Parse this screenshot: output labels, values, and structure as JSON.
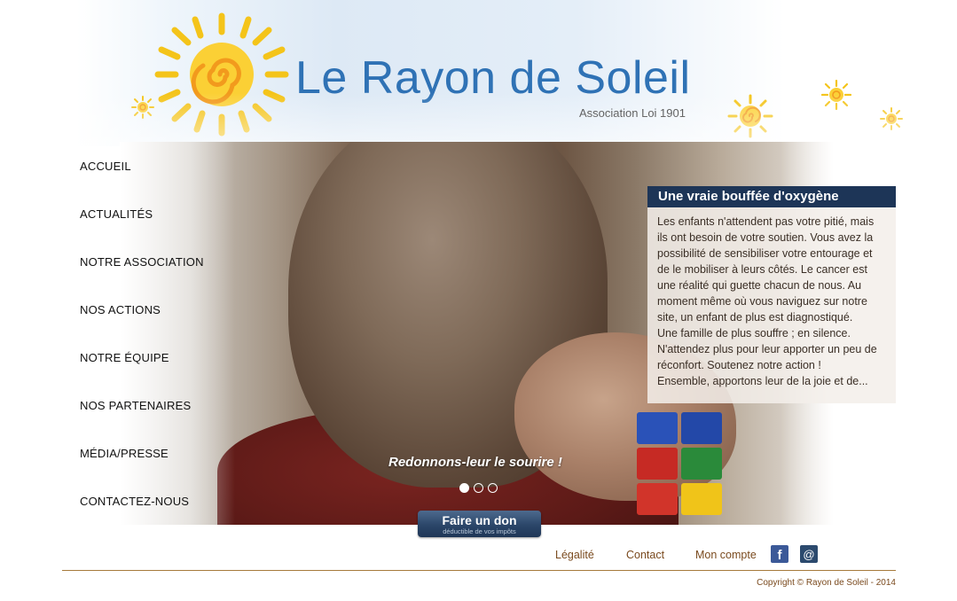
{
  "header": {
    "title": "Le Rayon de Soleil",
    "subtitle": "Association Loi 1901"
  },
  "nav": {
    "items": [
      {
        "label": "ACCUEIL"
      },
      {
        "label": "ACTUALITÉS"
      },
      {
        "label": "NOTRE ASSOCIATION"
      },
      {
        "label": "NOS ACTIONS"
      },
      {
        "label": "NOTRE ÉQUIPE"
      },
      {
        "label": "NOS PARTENAIRES"
      },
      {
        "label": "MÉDIA/PRESSE"
      },
      {
        "label": "CONTACTEZ-NOUS"
      }
    ]
  },
  "hero": {
    "caption": "Redonnons-leur le sourire !",
    "slide_count": 3,
    "active_slide": 1
  },
  "info_box": {
    "title": "Une vraie bouffée d'oxygène",
    "lines": [
      "Les enfants n'attendent pas votre pitié, mais",
      "ils ont besoin de votre soutien. Vous avez la",
      "possibilité de sensibiliser votre entourage et",
      "de le mobiliser à leurs côtés. Le cancer est",
      "une réalité qui guette chacun de nous. Au",
      "moment même où vous naviguez sur notre",
      "site, un enfant de plus est diagnostiqué.",
      "Une famille de plus souffre ; en silence.",
      "N'attendez plus pour leur apporter un peu de",
      "réconfort. Soutenez notre action !",
      "Ensemble, apportons leur de la joie et de..."
    ]
  },
  "donate": {
    "label": "Faire un don",
    "sublabel": "déductible de vos impôts"
  },
  "footer": {
    "links": [
      {
        "label": "Légalité"
      },
      {
        "label": "Contact"
      },
      {
        "label": "Mon compte"
      }
    ],
    "facebook_icon": "f",
    "email_icon": "@",
    "copyright": "Copyright © Rayon de Soleil - 2014"
  },
  "colors": {
    "title_blue": "#2f72b5",
    "nav_text": "#111111",
    "box_header": "#1d3557",
    "footer_brown": "#7a4a1e",
    "sun_yellow": "#f4c41a",
    "sun_orange": "#f29a1d"
  }
}
